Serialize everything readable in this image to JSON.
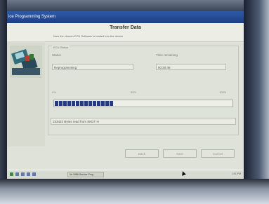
{
  "window": {
    "title": "ice Programming System"
  },
  "header": {
    "title": "Transfer Data",
    "subtitle": "Now the chosen ECU Software is loaded into the device"
  },
  "ecu_status": {
    "group_label": "ECU Status",
    "status_label": "Status",
    "status_value": "Reprogramming",
    "time_label": "Time remaining",
    "time_value": "00:20:48"
  },
  "progress": {
    "marker_0": "0%",
    "marker_50": "50%",
    "marker_100": "100%",
    "fraction": 0.33
  },
  "log": {
    "message": "153432 Bytes read from SKDT H"
  },
  "buttons": {
    "back": "Back",
    "next": "Next",
    "cancel": "Cancel"
  },
  "taskbar": {
    "task_label": "Ve 1986 Service Prog",
    "tray": "1:51 PM"
  },
  "colors": {
    "progress_fill": "#233a8c",
    "titlebar": "#2f5aa8"
  }
}
